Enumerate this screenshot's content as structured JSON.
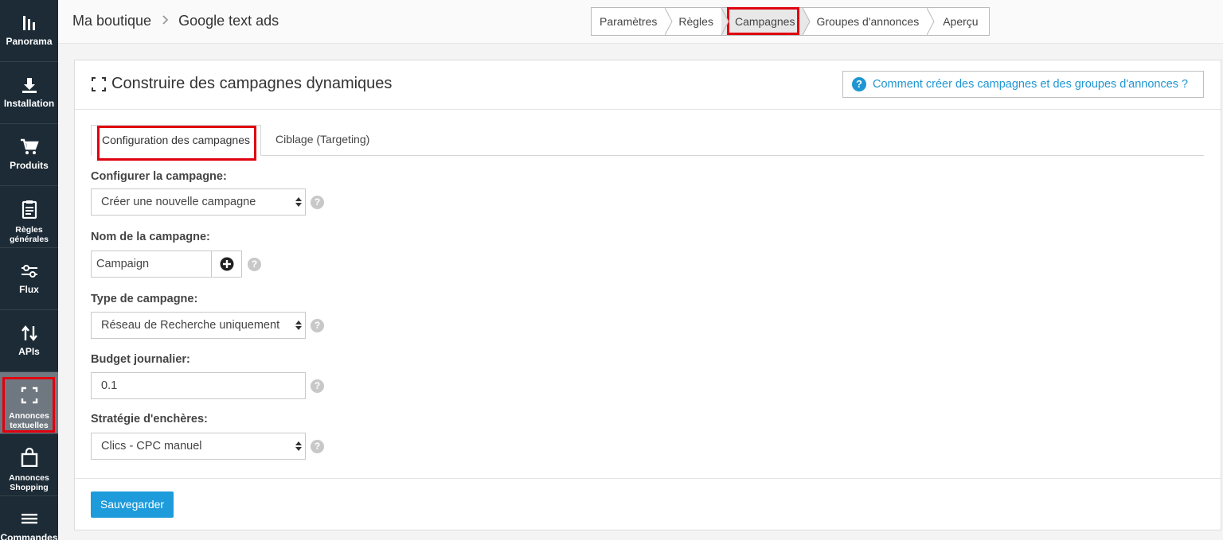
{
  "sidebar": {
    "items": [
      {
        "label": "Panorama",
        "icon": "bar-chart-icon"
      },
      {
        "label": "Installation",
        "icon": "download-icon"
      },
      {
        "label": "Produits",
        "icon": "cart-icon"
      },
      {
        "label": "Règles générales",
        "icon": "clipboard-icon"
      },
      {
        "label": "Flux",
        "icon": "sliders-icon"
      },
      {
        "label": "APIs",
        "icon": "arrows-up-down-icon"
      },
      {
        "label": "Annonces textuelles",
        "icon": "expand-corners-icon",
        "active": true
      },
      {
        "label": "Annonces Shopping",
        "icon": "shopping-bag-icon"
      },
      {
        "label": "Commandes",
        "icon": "list-icon"
      }
    ]
  },
  "header": {
    "breadcrumb": [
      "Ma boutique",
      "Google text ads"
    ],
    "steps": [
      "Paramètres",
      "Règles",
      "Campagnes",
      "Groupes d'annonces",
      "Aperçu"
    ],
    "current_step": "Campagnes"
  },
  "panel": {
    "title": "Construire des campagnes dynamiques",
    "help_link": "Comment créer des campagnes et des groupes d'annonces ?",
    "tabs": [
      "Configuration des campagnes",
      "Ciblage (Targeting)"
    ],
    "fields": {
      "configure": {
        "label": "Configurer la campagne:",
        "value": "Créer une nouvelle campagne"
      },
      "name": {
        "label": "Nom de la campagne:",
        "value": "Campaign"
      },
      "type": {
        "label": "Type de campagne:",
        "value": "Réseau de Recherche uniquement"
      },
      "budget": {
        "label": "Budget journalier:",
        "value": "0.1"
      },
      "strategy": {
        "label": "Stratégie d'enchères:",
        "value": "Clics - CPC manuel"
      }
    },
    "help_mark": "?",
    "save_label": "Sauvegarder"
  },
  "colors": {
    "accent": "#1e9bdb",
    "highlight": "#e0000f",
    "sidebar": "#1c2b36"
  }
}
